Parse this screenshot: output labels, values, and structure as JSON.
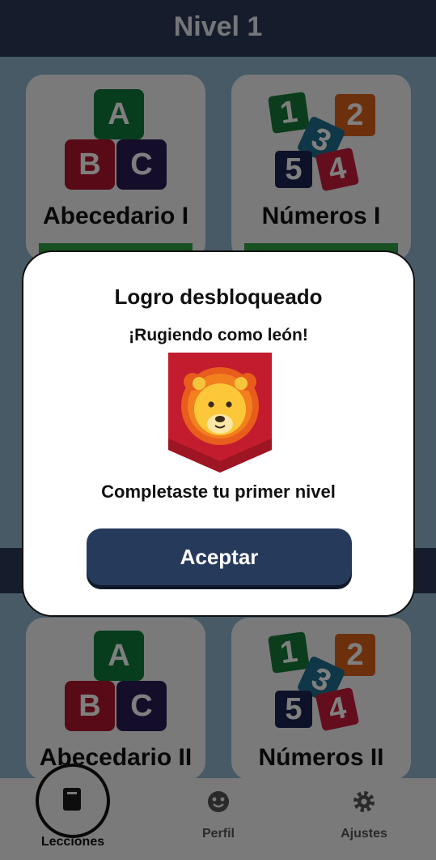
{
  "header": {
    "title": "Nivel 1"
  },
  "lessons": [
    {
      "title": "Abecedario I",
      "type": "letters"
    },
    {
      "title": "Números I",
      "type": "numbers"
    },
    {
      "title": "Abecedario II",
      "type": "letters"
    },
    {
      "title": "Números II",
      "type": "numbers"
    }
  ],
  "letter_blocks": [
    "A",
    "B",
    "C"
  ],
  "number_blocks": [
    "1",
    "2",
    "3",
    "5",
    "4"
  ],
  "bottom_nav": {
    "items": [
      {
        "label": "Lecciones",
        "icon": "book-icon",
        "active": true
      },
      {
        "label": "Perfil",
        "icon": "face-icon",
        "active": false
      },
      {
        "label": "Ajustes",
        "icon": "gear-icon",
        "active": false
      }
    ]
  },
  "dialog": {
    "title": "Logro desbloqueado",
    "achievement_name": "¡Rugiendo como león!",
    "badge_icon": "lion-badge-icon",
    "description": "Completaste tu primer nivel",
    "accept_label": "Aceptar"
  },
  "colors": {
    "header": "#2a3b58",
    "background": "#8fb4cc",
    "button": "#263a5c",
    "badge": "#c21c2e",
    "progress": "#2ea043"
  }
}
